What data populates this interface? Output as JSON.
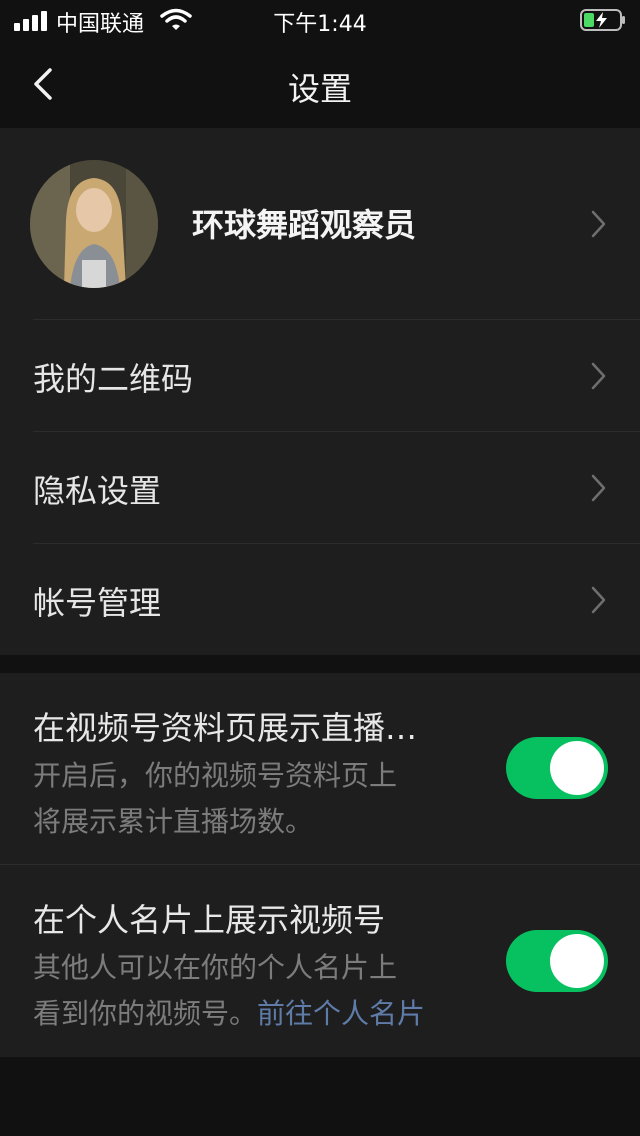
{
  "status_bar": {
    "carrier": "中国联通",
    "time": "下午1:44"
  },
  "nav": {
    "title": "设置"
  },
  "profile": {
    "name": "环球舞蹈观察员"
  },
  "menu": [
    {
      "label": "我的二维码"
    },
    {
      "label": "隐私设置"
    },
    {
      "label": "帐号管理"
    }
  ],
  "toggles": [
    {
      "title": "在视频号资料页展示直播…",
      "desc_line1": "开启后，你的视频号资料页上",
      "desc_line2": "将展示累计直播场数。",
      "enabled": true
    },
    {
      "title": "在个人名片上展示视频号",
      "desc_line1": "其他人可以在你的个人名片上",
      "desc_line2": "看到你的视频号。",
      "link": "前往个人名片",
      "enabled": true
    }
  ],
  "colors": {
    "accent": "#07c160",
    "link": "#5f7ba8",
    "background": "#111111",
    "card": "#1e1e1e"
  }
}
